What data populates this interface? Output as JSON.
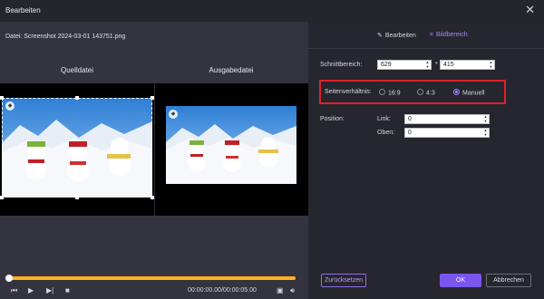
{
  "window": {
    "title": "Bearbeiten",
    "close_icon": "close-icon"
  },
  "file": {
    "label": "Datei: Screenshot 2024-03-01 143751.png"
  },
  "preview": {
    "source_label": "Quelldatei",
    "output_label": "Ausgabedatei"
  },
  "playback": {
    "time": "00:00:00.00/00:00:05.00",
    "progress": 1.0
  },
  "tabs": [
    {
      "label": "Bearbeiten",
      "icon": "edit-icon"
    },
    {
      "label": "Bildbereich",
      "icon": "crop-icon"
    }
  ],
  "crop": {
    "label": "Schnittbereich:",
    "width": "629",
    "height": "415",
    "separator": "*"
  },
  "aspect": {
    "label": "Seitenverhältnis:",
    "options": [
      "16:9",
      "4:3",
      "Manuell"
    ],
    "selected": "Manuell"
  },
  "position": {
    "label": "Position:",
    "left_label": "Link:",
    "left_value": "0",
    "top_label": "Oben:",
    "top_value": "0"
  },
  "buttons": {
    "reset": "Zurücksetzen",
    "ok": "OK",
    "cancel": "Abbrechen"
  },
  "colors": {
    "accent": "#7a55ee",
    "highlight_box": "#e0202a",
    "progress": "#ffb020"
  }
}
